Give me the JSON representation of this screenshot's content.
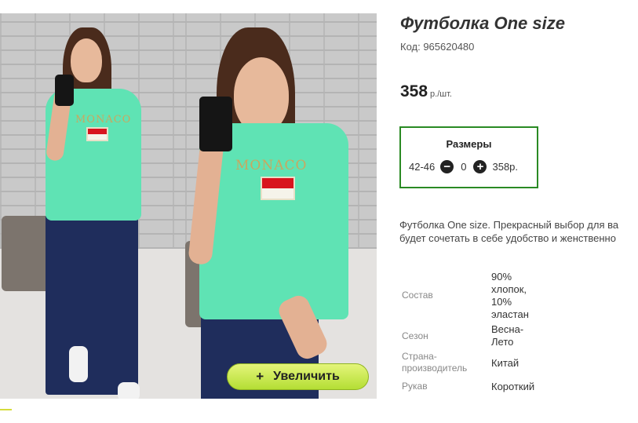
{
  "product": {
    "title": "Футболка One size",
    "sku": "Код: 965620480",
    "price": "358",
    "price_unit": "р./шт."
  },
  "gallery": {
    "zoom_label": "Увеличить",
    "zoom_icon": "+",
    "print_text": "MONACO"
  },
  "sizes": {
    "title": "Размеры",
    "row": {
      "label": "42-46",
      "qty": "0",
      "price": "358р."
    }
  },
  "description": {
    "line1": "Футболка One size. Прекрасный выбор для ва",
    "line2": "будет сочетать в себе удобство и женственно"
  },
  "specs": [
    {
      "key": "Состав",
      "value": "90% хлопок, 10% эластан"
    },
    {
      "key": "Сезон",
      "value": "Весна-Лето"
    },
    {
      "key": "Страна-производитель",
      "value": "Китай"
    },
    {
      "key": "Рукав",
      "value": "Короткий"
    }
  ],
  "colors": {
    "sizes_border": "#2a8a24",
    "zoom_button": "#c6e84a",
    "tee": "#5fe3b4"
  }
}
